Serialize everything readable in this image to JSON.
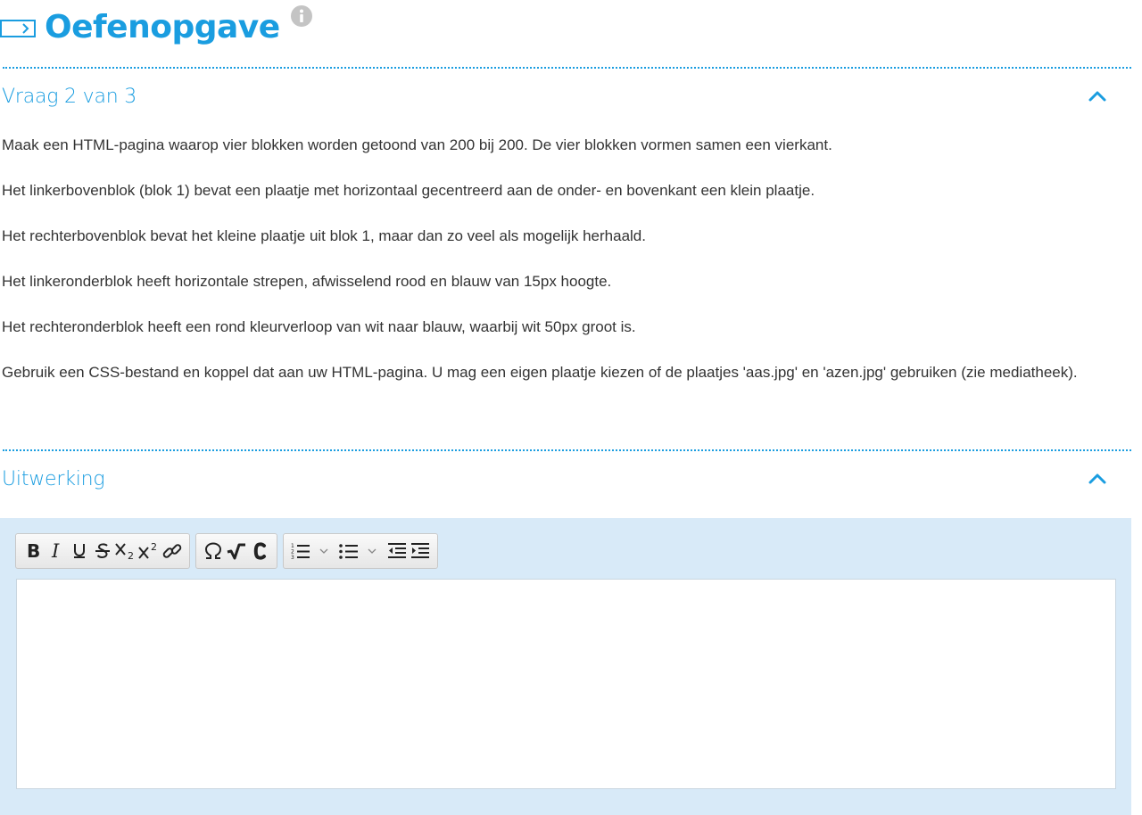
{
  "header": {
    "title": "Oefenopgave",
    "icon": "exercise-arrow-icon",
    "info_icon": "info-icon"
  },
  "question_section": {
    "title": "Vraag 2 van 3",
    "expanded": true,
    "paragraphs": [
      "Maak een HTML-pagina waarop vier blokken worden getoond van 200 bij 200. De vier blokken vormen samen een vierkant.",
      "Het linkerbovenblok (blok 1) bevat een plaatje met horizontaal gecentreerd aan de onder- en bovenkant een klein plaatje.",
      "Het rechterbovenblok bevat het kleine plaatje uit blok 1, maar dan zo veel als mogelijk herhaald.",
      "Het linkeronderblok heeft horizontale strepen, afwisselend rood en blauw van 15px hoogte.",
      "Het rechteronderblok heeft een rond kleurverloop van wit naar blauw, waarbij wit 50px groot is.",
      "Gebruik een CSS-bestand en koppel dat aan uw HTML-pagina. U mag een eigen plaatje kiezen of de plaatjes 'aas.jpg' en 'azen.jpg' gebruiken (zie mediatheek)."
    ]
  },
  "answer_section": {
    "title": "Uitwerking",
    "expanded": true,
    "editor_value": ""
  },
  "toolbar": {
    "groups": [
      [
        "bold",
        "italic",
        "underline",
        "strikethrough",
        "subscript",
        "superscript",
        "link"
      ],
      [
        "special-character",
        "math-formula",
        "code"
      ],
      [
        "numbered-list",
        "bulleted-list",
        "outdent",
        "indent"
      ]
    ]
  },
  "colors": {
    "accent": "#1a9de0",
    "editor_background": "#d8eaf8",
    "text": "#333333"
  }
}
